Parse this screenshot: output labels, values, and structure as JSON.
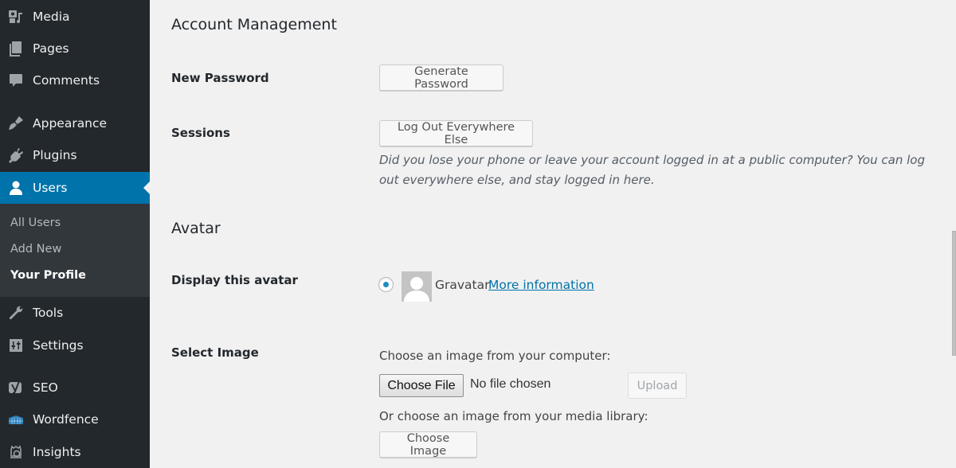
{
  "sidebar": {
    "items": [
      {
        "label": "Media",
        "icon": "media-icon"
      },
      {
        "label": "Pages",
        "icon": "pages-icon"
      },
      {
        "label": "Comments",
        "icon": "comments-icon"
      },
      {
        "label": "Appearance",
        "icon": "appearance-icon"
      },
      {
        "label": "Plugins",
        "icon": "plugins-icon"
      },
      {
        "label": "Users",
        "icon": "users-icon",
        "active": true
      },
      {
        "label": "Tools",
        "icon": "tools-icon"
      },
      {
        "label": "Settings",
        "icon": "settings-icon"
      },
      {
        "label": "SEO",
        "icon": "yoast-seo-icon"
      },
      {
        "label": "Wordfence",
        "icon": "wordfence-icon"
      },
      {
        "label": "Insights",
        "icon": "insights-icon"
      }
    ],
    "submenu": [
      {
        "label": "All Users"
      },
      {
        "label": "Add New"
      },
      {
        "label": "Your Profile",
        "current": true
      }
    ],
    "colors": {
      "background": "#23282d",
      "active": "#0073aa",
      "submenu_bg": "#32373c"
    }
  },
  "account": {
    "title": "Account Management",
    "new_password_label": "New Password",
    "generate_password_button": "Generate Password",
    "sessions_label": "Sessions",
    "logout_everywhere_button": "Log Out Everywhere Else",
    "sessions_description": "Did you lose your phone or leave your account logged in at a public computer? You can log out everywhere else, and stay logged in here."
  },
  "avatar": {
    "title": "Avatar",
    "display_label": "Display this avatar",
    "option_label": "Gravatar",
    "option_selected": true,
    "more_info_link": "More information",
    "select_image_label": "Select Image",
    "choose_computer_text": "Choose an image from your computer:",
    "choose_file_button": "Choose File",
    "file_status": "No file chosen",
    "upload_button": "Upload",
    "choose_library_text": "Or choose an image from your media library:",
    "choose_image_button": "Choose Image"
  }
}
